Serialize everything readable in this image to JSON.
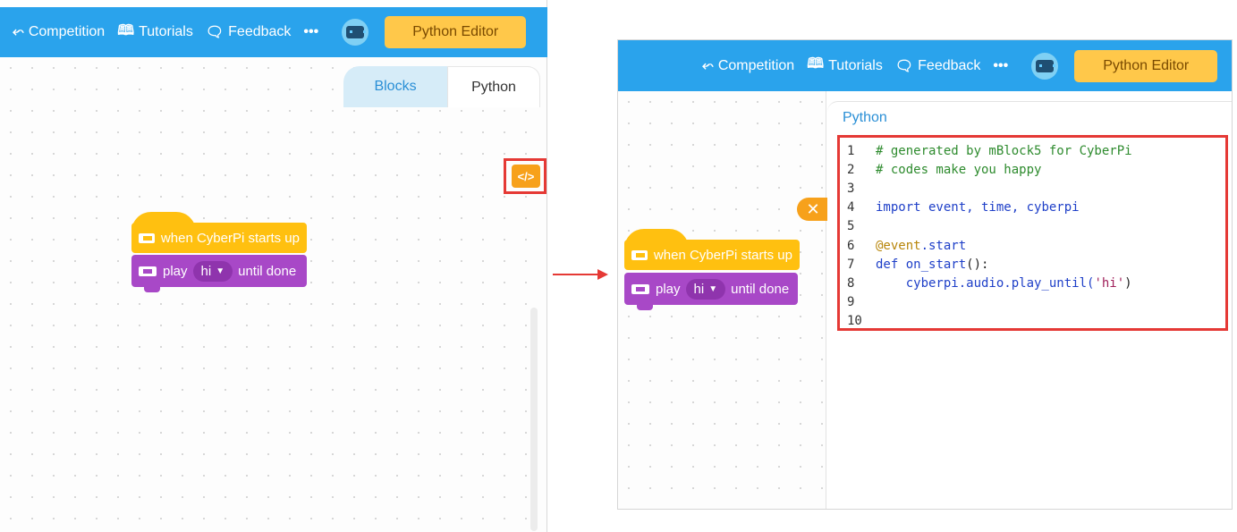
{
  "colors": {
    "topbar": "#2aa3ec",
    "python_button": "#ffc84a",
    "event_block": "#ffc010",
    "audio_block": "#a848c7",
    "highlight": "#e53935",
    "toggle_button": "#f7a11b"
  },
  "left_panel": {
    "nav": {
      "competition": "Competition",
      "tutorials": "Tutorials",
      "feedback": "Feedback",
      "more": "•••"
    },
    "python_editor_label": "Python Editor",
    "tabs": {
      "blocks": "Blocks",
      "python": "Python"
    },
    "toggle_icon": "code-toggle-icon",
    "blocks": {
      "hat_label": "when CyberPi starts up",
      "play_label": "play",
      "sound_value": "hi",
      "until_done": "until done"
    }
  },
  "right_panel": {
    "nav": {
      "competition": "Competition",
      "tutorials": "Tutorials",
      "feedback": "Feedback",
      "more": "•••"
    },
    "python_editor_label": "Python Editor",
    "code_panel_title": "Python",
    "close_icon": "close-icon",
    "blocks": {
      "hat_label": "when CyberPi starts up",
      "play_label": "play",
      "sound_value": "hi",
      "until_done": "until done"
    },
    "code_lines": [
      {
        "n": "1",
        "parts": [
          {
            "t": "# generated by mBlock5 for CyberPi",
            "c": "c-comment"
          }
        ]
      },
      {
        "n": "2",
        "parts": [
          {
            "t": "# codes make you happy",
            "c": "c-comment"
          }
        ]
      },
      {
        "n": "3",
        "parts": []
      },
      {
        "n": "4",
        "parts": [
          {
            "t": "import",
            "c": "c-kw"
          },
          {
            "t": " event, time, cyberpi",
            "c": "c-fn"
          }
        ]
      },
      {
        "n": "5",
        "parts": []
      },
      {
        "n": "6",
        "parts": [
          {
            "t": "@event",
            "c": "c-dec"
          },
          {
            "t": ".start",
            "c": "c-fn"
          }
        ]
      },
      {
        "n": "7",
        "parts": [
          {
            "t": "def",
            "c": "c-kw"
          },
          {
            "t": " on_start",
            "c": "c-fn"
          },
          {
            "t": "():",
            "c": "c-plain"
          }
        ]
      },
      {
        "n": "8",
        "parts": [
          {
            "t": "    cyberpi.audio.play_until(",
            "c": "c-fn"
          },
          {
            "t": "'hi'",
            "c": "c-str"
          },
          {
            "t": ")",
            "c": "c-plain"
          }
        ]
      },
      {
        "n": "9",
        "parts": []
      },
      {
        "n": "10",
        "parts": []
      }
    ]
  }
}
